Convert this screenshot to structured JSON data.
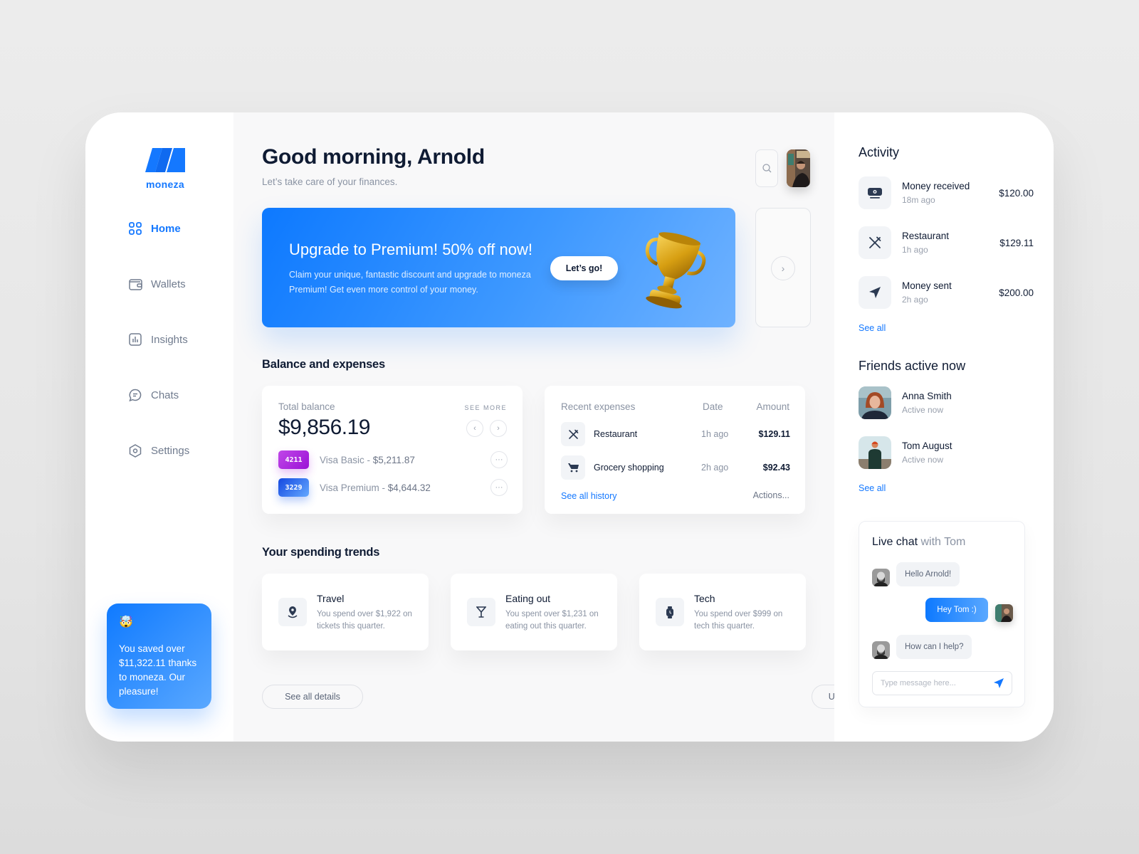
{
  "brand": {
    "name": "moneza",
    "accent": "#1478ff"
  },
  "sidebar": {
    "items": [
      {
        "label": "Home",
        "icon": "grid-icon",
        "active": true
      },
      {
        "label": "Wallets",
        "icon": "wallet-icon",
        "active": false
      },
      {
        "label": "Insights",
        "icon": "chart-icon",
        "active": false
      },
      {
        "label": "Chats",
        "icon": "chat-icon",
        "active": false
      },
      {
        "label": "Settings",
        "icon": "settings-icon",
        "active": false
      }
    ],
    "saved_card": {
      "emoji": "🤯",
      "text": "You saved over $11,322.11 thanks to moneza. Our pleasure!"
    }
  },
  "header": {
    "greeting": "Good morning, Arnold",
    "subtitle": "Let’s take care of your finances."
  },
  "promo": {
    "title": "Upgrade to Premium! 50% off now!",
    "text": "Claim your unique, fantastic discount and upgrade to moneza Premium! Get even more control of your money.",
    "button": "Let’s go!"
  },
  "balance": {
    "section_title": "Balance and expenses",
    "label": "Total balance",
    "see_more": "SEE MORE",
    "amount": "$9,856.19",
    "accounts": [
      {
        "number": "4211",
        "name": "Visa Basic",
        "amount": "$5,211.87",
        "color": "#b033e0"
      },
      {
        "number": "3229",
        "name": "Visa Premium",
        "amount": "$4,644.32",
        "color": "#1d5df0"
      }
    ]
  },
  "expenses": {
    "headers": {
      "name": "Recent expenses",
      "date": "Date",
      "amount": "Amount"
    },
    "rows": [
      {
        "name": "Restaurant",
        "date": "1h ago",
        "amount": "$129.11",
        "icon": "utensils-icon"
      },
      {
        "name": "Grocery shopping",
        "date": "2h ago",
        "amount": "$92.43",
        "icon": "cart-icon"
      }
    ],
    "see_all": "See all history",
    "actions": "Actions..."
  },
  "trends": {
    "section_title": "Your spending trends",
    "items": [
      {
        "title": "Travel",
        "text": "You spend over $1,922 on tickets this quarter.",
        "icon": "location-pin-icon"
      },
      {
        "title": "Eating out",
        "text": "You spent over $1,231 on eating out this quarter.",
        "icon": "cocktail-icon"
      },
      {
        "title": "Tech",
        "text": "You spend over $999 on tech this quarter.",
        "icon": "smartwatch-icon"
      }
    ]
  },
  "footer": {
    "see_details": "See all details",
    "update": "Update available!"
  },
  "activity": {
    "title": "Activity",
    "items": [
      {
        "name": "Money received",
        "time": "18m ago",
        "amount": "$120.00",
        "icon": "cash-icon"
      },
      {
        "name": "Restaurant",
        "time": "1h ago",
        "amount": "$129.11",
        "icon": "utensils-icon"
      },
      {
        "name": "Money sent",
        "time": "2h ago",
        "amount": "$200.00",
        "icon": "send-icon"
      }
    ],
    "see_all": "See all"
  },
  "friends": {
    "title": "Friends active now",
    "items": [
      {
        "name": "Anna Smith",
        "status": "Active now"
      },
      {
        "name": "Tom August",
        "status": "Active now"
      }
    ],
    "see_all": "See all"
  },
  "chat": {
    "title": "Live chat",
    "with": "with Tom",
    "messages": [
      {
        "from": "Tom",
        "text": "Hello Arnold!"
      },
      {
        "from": "me",
        "text": "Hey Tom :)"
      },
      {
        "from": "Tom",
        "text": "How can I help?"
      }
    ],
    "placeholder": "Type message here..."
  }
}
